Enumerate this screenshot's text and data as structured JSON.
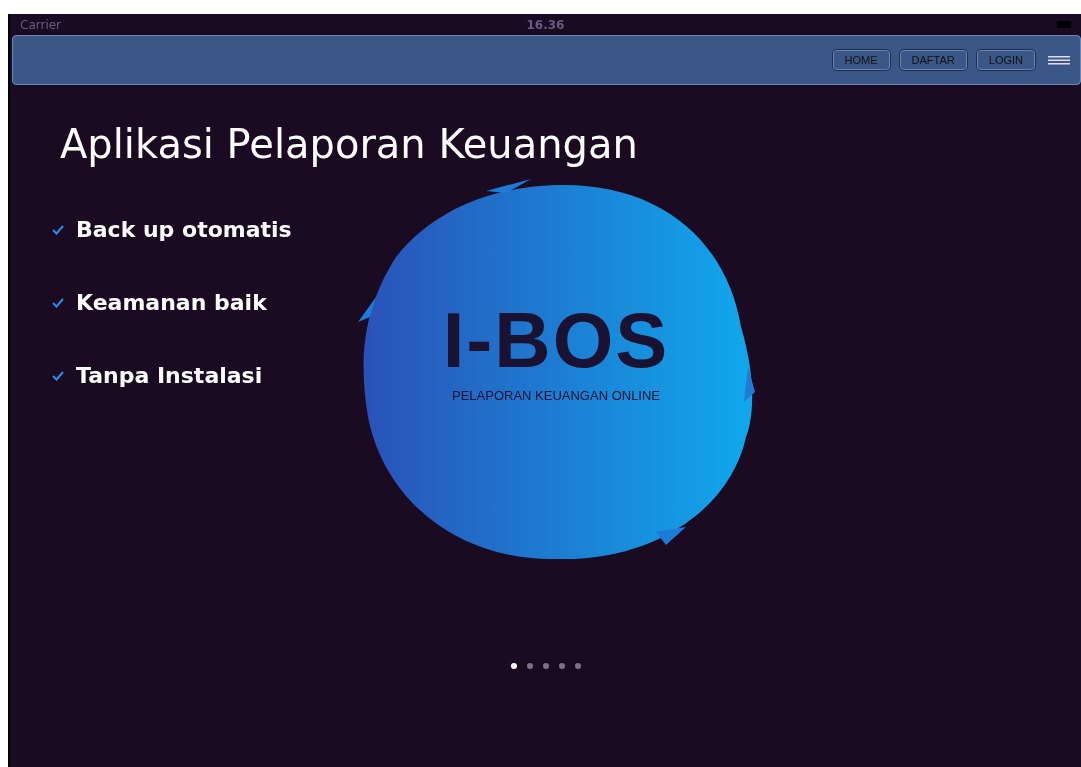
{
  "status_bar": {
    "carrier": "Carrier",
    "time": "16.36"
  },
  "nav": {
    "buttons": [
      {
        "label": "HOME"
      },
      {
        "label": "DAFTAR"
      },
      {
        "label": "LOGIN"
      }
    ]
  },
  "title": "Aplikasi Pelaporan Keuangan",
  "features": [
    {
      "label": "Back up otomatis",
      "checked": true
    },
    {
      "label": "Keamanan baik",
      "checked": true
    },
    {
      "label": "Tanpa Instalasi",
      "checked": true
    }
  ],
  "logo": {
    "name": "I-BOS",
    "tagline": "PELAPORAN KEUANGAN ONLINE"
  },
  "pager": [
    {
      "selected": true
    },
    {
      "selected": false
    },
    {
      "selected": false
    },
    {
      "selected": false
    },
    {
      "selected": false
    }
  ]
}
